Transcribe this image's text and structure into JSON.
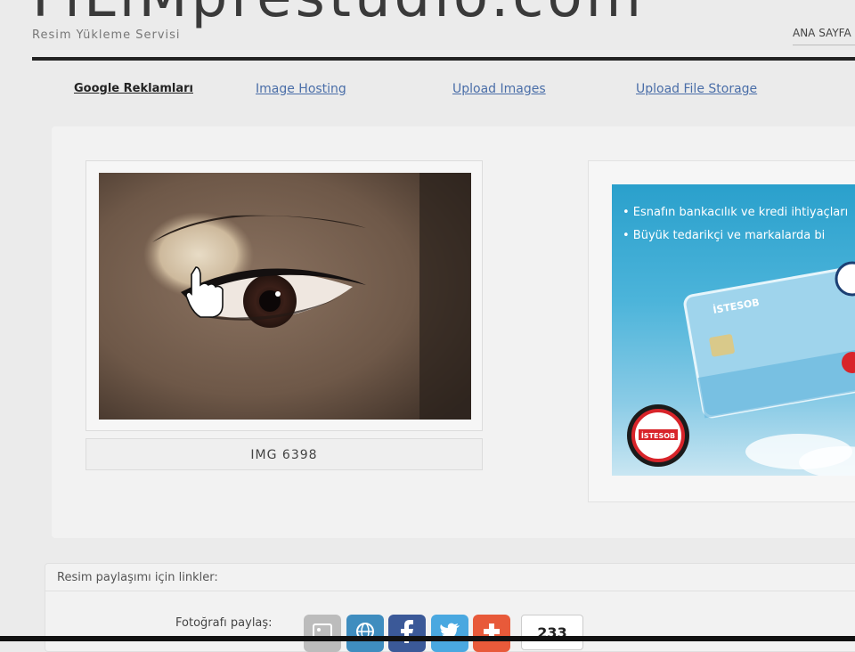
{
  "header": {
    "site_title": "FiLiMprestudio.com",
    "tagline": "Resim Yükleme Servisi",
    "home_link": "ANA SAYFA"
  },
  "nav": {
    "items": [
      {
        "label": "Google Reklamları"
      },
      {
        "label": "Image Hosting"
      },
      {
        "label": "Upload Images"
      },
      {
        "label": "Upload File Storage"
      }
    ]
  },
  "photo": {
    "caption": "IMG 6398"
  },
  "ad": {
    "line1": "• Esnafın bankacılık ve kredi ihtiyaçları",
    "line2": "• Büyük tedarikçi ve markalarda bi",
    "card_text": "İSTESOB",
    "badge_text": "İSTESOB"
  },
  "share": {
    "header": "Resim paylaşımı için linkler:",
    "label": "Fotoğrafı paylaş:",
    "count": "233",
    "buttons": [
      {
        "icon": "gallery-icon",
        "color": "#bcbcbc"
      },
      {
        "icon": "globe-icon",
        "color": "#3f8dbf"
      },
      {
        "icon": "facebook-icon",
        "color": "#3b5998"
      },
      {
        "icon": "twitter-icon",
        "color": "#4aa8e0"
      },
      {
        "icon": "plus-icon",
        "color": "#e85a3a"
      }
    ]
  }
}
